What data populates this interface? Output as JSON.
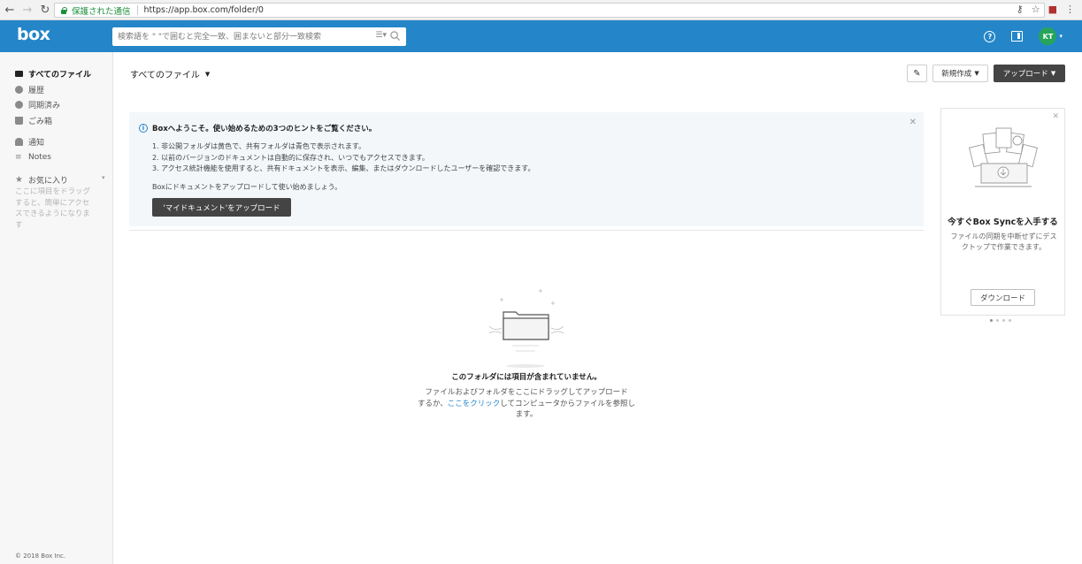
{
  "browser": {
    "secure_label": "保護された通信",
    "url": "https://app.box.com/folder/0"
  },
  "topbar": {
    "logo": "box",
    "search_placeholder": "検索語を \" \"で囲むと完全一致、囲まないと部分一致検索",
    "avatar_initials": "KT"
  },
  "sidebar": {
    "items": [
      {
        "label": "すべてのファイル",
        "icon": "folder-icon"
      },
      {
        "label": "履歴",
        "icon": "clock-icon"
      },
      {
        "label": "同期済み",
        "icon": "sync-icon"
      },
      {
        "label": "ごみ箱",
        "icon": "trash-icon"
      },
      {
        "label": "通知",
        "icon": "bell-icon"
      },
      {
        "label": "Notes",
        "icon": "notes-icon"
      },
      {
        "label": "お気に入り",
        "icon": "star-icon"
      }
    ],
    "favorites_hint": "ここに項目をドラッグすると、簡単にアクセスできるようになります",
    "copyright": "© 2018 Box Inc."
  },
  "main": {
    "breadcrumb": "すべてのファイル",
    "actions": {
      "new_label": "新規作成",
      "upload_label": "アップロード"
    },
    "welcome": {
      "title": "Boxへようこそ。使い始めるための3つのヒントをご覧ください。",
      "tips": [
        "1. 非公開フォルダは黄色で、共有フォルダは青色で表示されます。",
        "2. 以前のバージョンのドキュメントは自動的に保存され、いつでもアクセスできます。",
        "3. アクセス統計機能を使用すると、共有ドキュメントを表示、編集、またはダウンロードしたユーザーを確認できます。"
      ],
      "cta": "Boxにドキュメントをアップロードして使い始めましょう。",
      "button": "'マイドキュメント'をアップロード"
    },
    "empty": {
      "title": "このフォルダには項目が含まれていません。",
      "desc_line1": "ファイルおよびフォルダをここにドラッグしてアップロード",
      "desc_prefix": "するか、",
      "desc_link": "ここをクリック",
      "desc_suffix": "してコンピュータからファイルを参照します。"
    }
  },
  "promo": {
    "title": "今すぐBox Syncを入手する",
    "desc": "ファイルの同期を中断せずにデスクトップで作業できます。",
    "button": "ダウンロード",
    "page_count": 4,
    "active_page": 1
  }
}
